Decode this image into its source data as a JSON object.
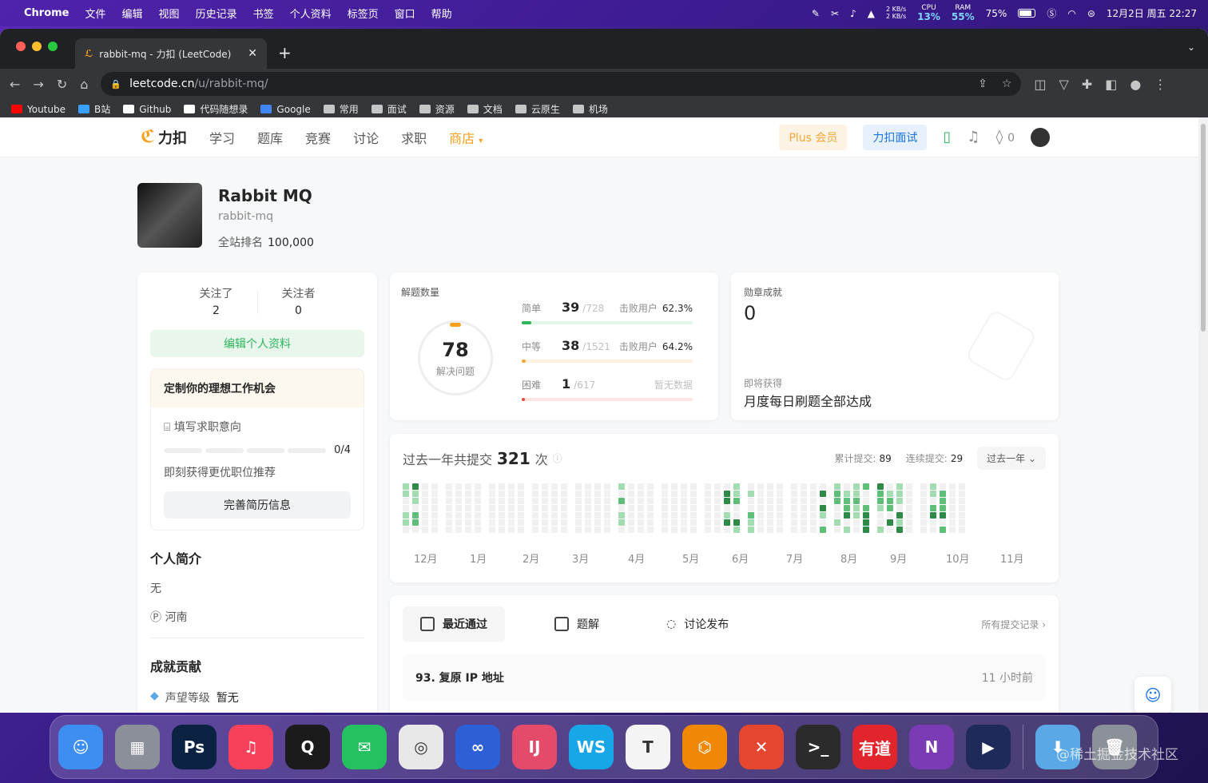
{
  "menubar": {
    "app": "Chrome",
    "items": [
      "文件",
      "编辑",
      "视图",
      "历史记录",
      "书签",
      "个人资料",
      "标签页",
      "窗口",
      "帮助"
    ],
    "net": [
      "2 KB/s",
      "2 KB/s"
    ],
    "cpu_label": "CPU",
    "cpu": "13%",
    "ram_label": "RAM",
    "ram": "55%",
    "battery": "75%",
    "datetime": "12月2日 周五 22:27"
  },
  "browser": {
    "tab_title": "rabbit-mq - 力扣 (LeetCode)",
    "url_host": "leetcode.cn",
    "url_path": "/u/rabbit-mq/",
    "bookmarks": [
      {
        "label": "Youtube",
        "color": "#ff0000"
      },
      {
        "label": "B站",
        "color": "#3aa0ff"
      },
      {
        "label": "Github",
        "color": "#ffffff"
      },
      {
        "label": "代码随想录",
        "color": "#ffffff"
      },
      {
        "label": "Google",
        "color": "#4285f4"
      },
      {
        "label": "常用",
        "color": "#c4c7c5"
      },
      {
        "label": "面试",
        "color": "#c4c7c5"
      },
      {
        "label": "资源",
        "color": "#c4c7c5"
      },
      {
        "label": "文档",
        "color": "#c4c7c5"
      },
      {
        "label": "云原生",
        "color": "#c4c7c5"
      },
      {
        "label": "机场",
        "color": "#c4c7c5"
      }
    ]
  },
  "nav": {
    "logo": "力扣",
    "items": [
      "学习",
      "题库",
      "竞赛",
      "讨论",
      "求职"
    ],
    "shop": "商店",
    "plus": "Plus 会员",
    "interview": "力扣面试",
    "streak": "0"
  },
  "profile": {
    "name": "Rabbit MQ",
    "username": "rabbit-mq",
    "rank_label": "全站排名",
    "rank": "100,000"
  },
  "side": {
    "following_label": "关注了",
    "following": "2",
    "followers_label": "关注者",
    "followers": "0",
    "edit": "编辑个人资料",
    "job_title": "定制你的理想工作机会",
    "job_item": "填写求职意向",
    "job_progress": "0/4",
    "job_desc": "即刻获得更优职位推荐",
    "resume_btn": "完善简历信息",
    "bio_title": "个人简介",
    "bio": "无",
    "location": "河南",
    "contrib_title": "成就贡献",
    "reputation_label": "声望等级",
    "reputation": "暂无"
  },
  "solved": {
    "title": "解题数量",
    "total": "78",
    "total_label": "解决问题",
    "beat_label": "击败用户",
    "levels": [
      {
        "name": "简单",
        "count": "39",
        "total": "/728",
        "beat": "62.3%",
        "ratio": 0.054,
        "color": "#2db55d",
        "track": "#e3f5e9"
      },
      {
        "name": "中等",
        "count": "38",
        "total": "/1521",
        "beat": "64.2%",
        "ratio": 0.025,
        "color": "#f4a73a",
        "track": "#fdf1df"
      },
      {
        "name": "困难",
        "count": "1",
        "total": "/617",
        "beat": "暂无数据",
        "ratio": 0.002,
        "color": "#ef4743",
        "track": "#fde4e3"
      }
    ]
  },
  "badge": {
    "title": "勋章成就",
    "count": "0",
    "next_label": "即将获得",
    "next": "月度每日刷题全部达成"
  },
  "calendar": {
    "prefix": "过去一年共提交",
    "total": "321",
    "suffix": "次",
    "cumulative_label": "累计提交:",
    "cumulative": "89",
    "streak_label": "连续提交:",
    "streak": "29",
    "range": "过去一年",
    "months": [
      "12月",
      "1月",
      "2月",
      "3月",
      "4月",
      "5月",
      "6月",
      "7月",
      "8月",
      "9月",
      "10月",
      "11月"
    ]
  },
  "recent": {
    "tabs": [
      "最近通过",
      "题解",
      "讨论发布"
    ],
    "all": "所有提交记录",
    "items": [
      {
        "title": "93. 复原 IP 地址",
        "time": "11 小时前"
      }
    ]
  },
  "dock": [
    {
      "name": "finder",
      "color": "#3d8ef0",
      "glyph": "☺"
    },
    {
      "name": "launchpad",
      "color": "#8a8f99",
      "glyph": "▦"
    },
    {
      "name": "photoshop",
      "color": "#0b2242",
      "glyph": "Ps"
    },
    {
      "name": "music",
      "color": "#f7415b",
      "glyph": "♫"
    },
    {
      "name": "qq",
      "color": "#1b1b1b",
      "glyph": "Q"
    },
    {
      "name": "wechat",
      "color": "#25c05f",
      "glyph": "✉"
    },
    {
      "name": "chrome",
      "color": "#e8e8e8",
      "glyph": "◎"
    },
    {
      "name": "navicat",
      "color": "#2d5fd6",
      "glyph": "∞"
    },
    {
      "name": "intellij",
      "color": "#e44a6a",
      "glyph": "IJ"
    },
    {
      "name": "webstorm",
      "color": "#17a6e8",
      "glyph": "WS"
    },
    {
      "name": "typora",
      "color": "#f4f4f4",
      "glyph": "T"
    },
    {
      "name": "drawio",
      "color": "#f08705",
      "glyph": "⌬"
    },
    {
      "name": "xmind",
      "color": "#e5462f",
      "glyph": "✕"
    },
    {
      "name": "terminal",
      "color": "#2b2b2b",
      "glyph": ">_"
    },
    {
      "name": "youdao",
      "color": "#e0252c",
      "glyph": "有道"
    },
    {
      "name": "onenote",
      "color": "#7b3bb5",
      "glyph": "N"
    },
    {
      "name": "player",
      "color": "#1e2a5a",
      "glyph": "▶"
    },
    {
      "name": "downloads",
      "color": "#5aa9e6",
      "glyph": "⬇"
    },
    {
      "name": "trash",
      "color": "#8c9199",
      "glyph": "🗑"
    }
  ],
  "watermark": "@稀土掘金技术社区"
}
